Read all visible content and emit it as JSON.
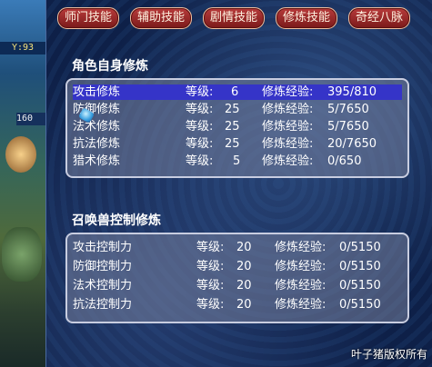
{
  "left_strip": {
    "label": "Y:93",
    "value": "160"
  },
  "tabs": [
    {
      "label": "师门技能"
    },
    {
      "label": "辅助技能"
    },
    {
      "label": "剧情技能"
    },
    {
      "label": "修炼技能"
    },
    {
      "label": "奇经八脉"
    }
  ],
  "self_section": {
    "title": "角色自身修炼",
    "rows": [
      {
        "name": "攻击修炼",
        "level_label": "等级:",
        "level": "6",
        "exp_label": "修炼经验:",
        "exp": "395/810",
        "selected": true
      },
      {
        "name": "防御修炼",
        "level_label": "等级:",
        "level": "25",
        "exp_label": "修炼经验:",
        "exp": "5/7650"
      },
      {
        "name": "法术修炼",
        "level_label": "等级:",
        "level": "25",
        "exp_label": "修炼经验:",
        "exp": "5/7650"
      },
      {
        "name": "抗法修炼",
        "level_label": "等级:",
        "level": "25",
        "exp_label": "修炼经验:",
        "exp": "20/7650"
      },
      {
        "name": "猎术修炼",
        "level_label": "等级:",
        "level": "5",
        "exp_label": "修炼经验:",
        "exp": "0/650"
      }
    ]
  },
  "pet_section": {
    "title": "召唤兽控制修炼",
    "rows": [
      {
        "name": "攻击控制力",
        "level_label": "等级:",
        "level": "20",
        "exp_label": "修炼经验:",
        "exp": "0/5150"
      },
      {
        "name": "防御控制力",
        "level_label": "等级:",
        "level": "20",
        "exp_label": "修炼经验:",
        "exp": "0/5150"
      },
      {
        "name": "法术控制力",
        "level_label": "等级:",
        "level": "20",
        "exp_label": "修炼经验:",
        "exp": "0/5150"
      },
      {
        "name": "抗法控制力",
        "level_label": "等级:",
        "level": "20",
        "exp_label": "修炼经验:",
        "exp": "0/5150"
      }
    ]
  },
  "watermark": "叶子猪版权所有",
  "colors": {
    "selected_row": "#3534c8",
    "tab": "#9a2a2a"
  }
}
